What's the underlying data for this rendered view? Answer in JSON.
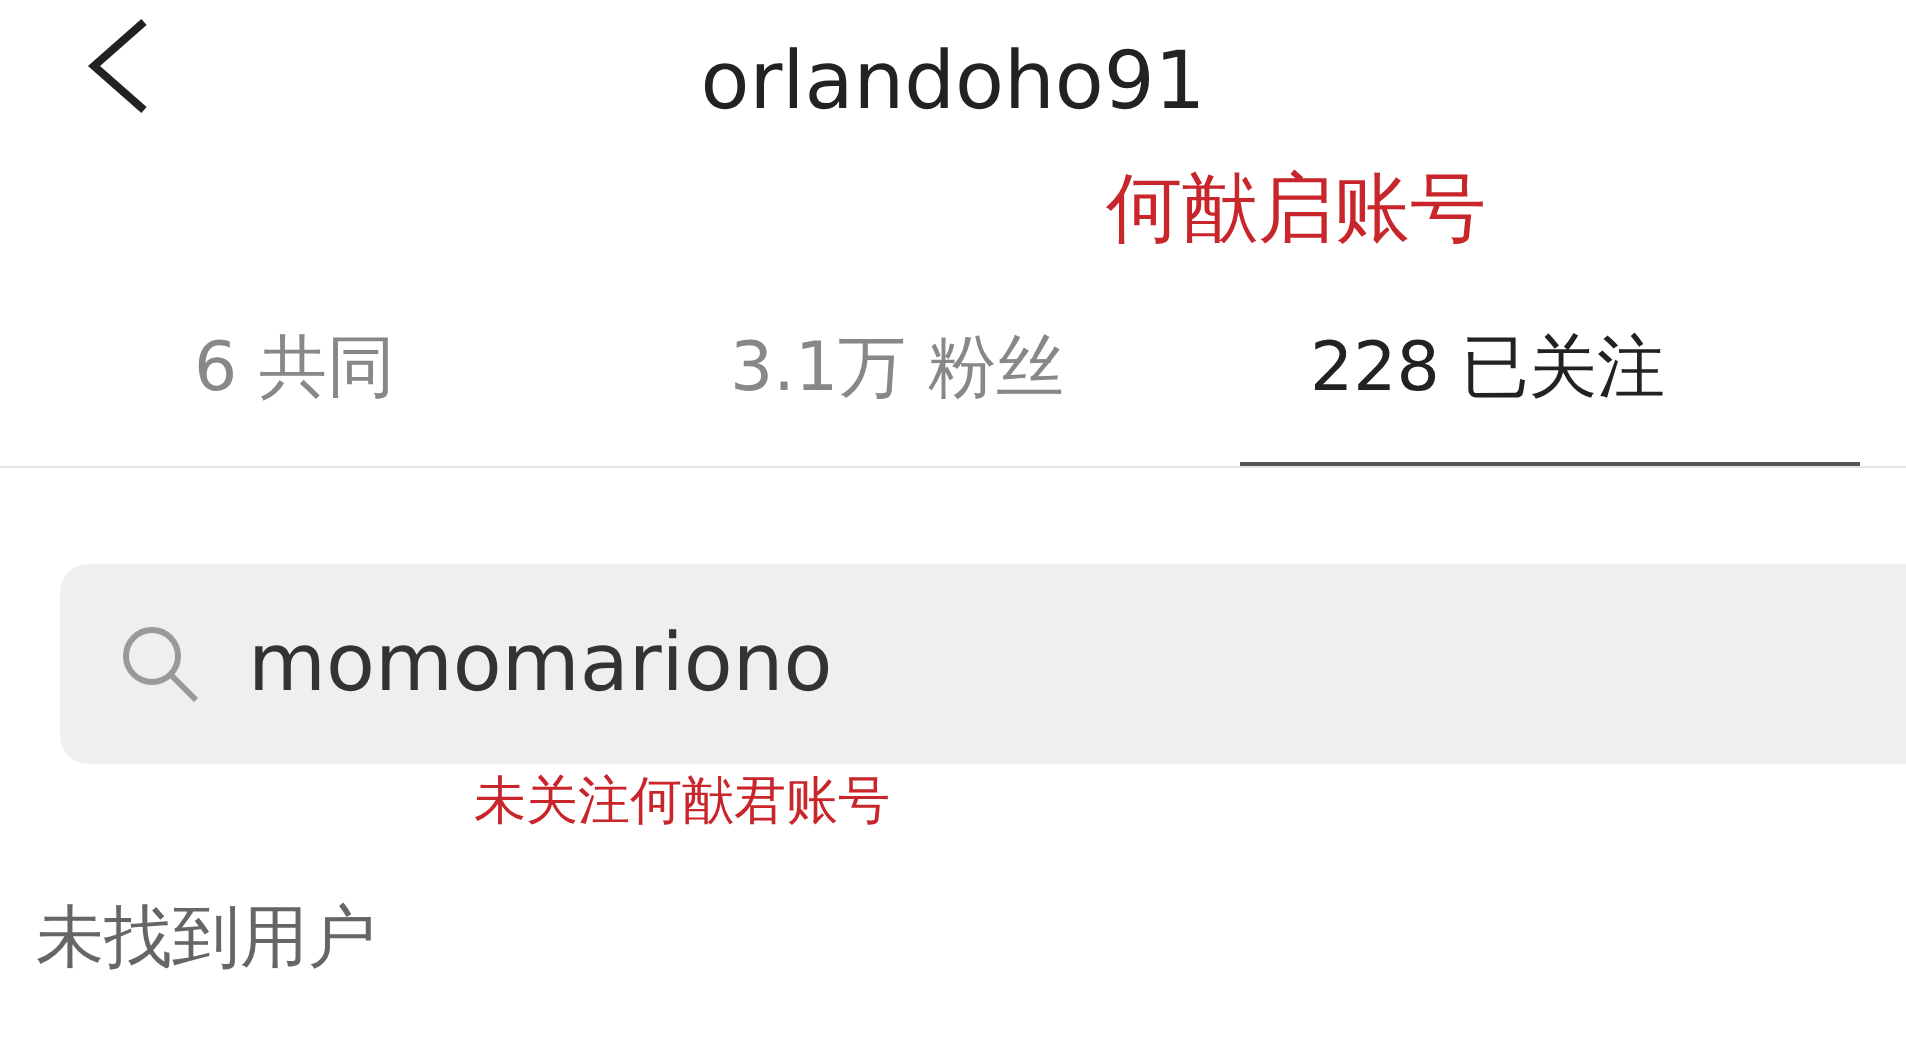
{
  "header": {
    "title": "orlandoho91",
    "annotation": "何猷启账号"
  },
  "tabs": [
    {
      "count": "6",
      "label": "共同",
      "selected": false
    },
    {
      "count": "3.1万",
      "label": "粉丝",
      "selected": false
    },
    {
      "count": "228",
      "label": "已关注",
      "selected": true
    }
  ],
  "search": {
    "value": "momomariono",
    "annotation": "未关注何猷君账号"
  },
  "empty_message": "未找到用户"
}
